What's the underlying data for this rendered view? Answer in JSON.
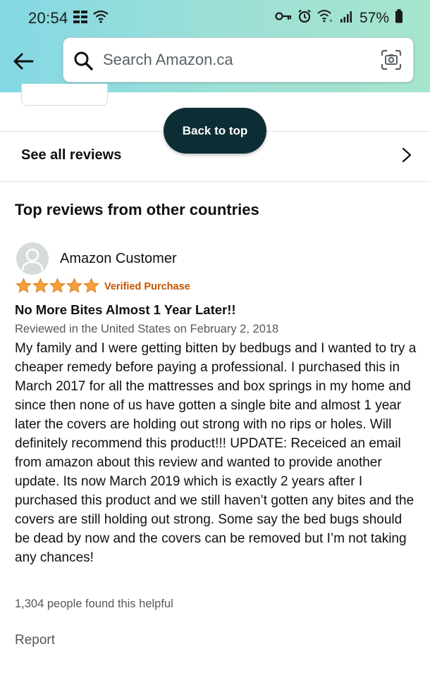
{
  "status_bar": {
    "time": "20:54",
    "battery_percent": "57%",
    "icons": [
      "grid-icon",
      "wifi-icon",
      "key-icon",
      "alarm-icon",
      "wifi-calling-icon",
      "signal-icon",
      "battery-icon"
    ]
  },
  "header": {
    "back_icon": "back-arrow-icon",
    "search_placeholder": "Search Amazon.ca",
    "camera_icon": "camera-icon"
  },
  "floating": {
    "back_to_top": "Back to top"
  },
  "reviews": {
    "see_all_label": "See all reviews",
    "section_heading": "Top reviews from other countries",
    "review": {
      "reviewer": "Amazon Customer",
      "rating": 5,
      "rating_max": 5,
      "badge": "Verified Purchase",
      "title": "No More Bites Almost 1 Year Later!!",
      "date": "Reviewed in the United States on February 2, 2018",
      "body": "My family and I were getting bitten by bedbugs and I wanted to try a cheaper remedy before paying a professional. I purchased this in March 2017 for all the mattresses and box springs in my home and since then none of us have gotten a single bite and almost 1 year later the covers are holding out strong with no rips or holes. Will definitely recommend this product!!! UPDATE: Receiced an email from amazon about this review and wanted to provide another update. Its now March 2019 which is exactly 2 years after I purchased this product and we still haven’t gotten any bites and the covers are still holding out strong. Some say the bed bugs should be dead by now and the covers can be removed but I’m not taking any chances!",
      "helpful": "1,304 people found this helpful",
      "report": "Report"
    }
  },
  "colors": {
    "header_gradient_start": "#84d8e4",
    "header_gradient_end": "#a6e4cc",
    "star": "#f4a13a",
    "verified": "#c45500",
    "back_to_top_bg": "#0c2d33"
  }
}
